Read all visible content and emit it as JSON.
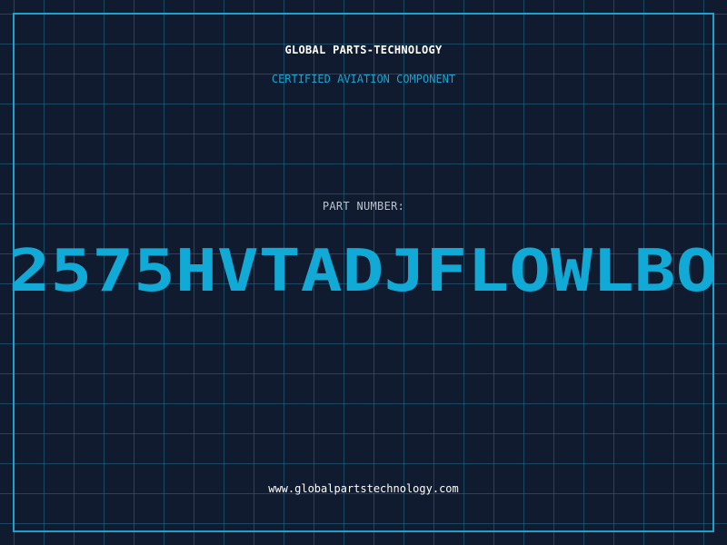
{
  "header": {
    "company_name": "GLOBAL PARTS-TECHNOLOGY",
    "subtitle": "CERTIFIED AVIATION COMPONENT"
  },
  "part": {
    "label": "PART NUMBER:",
    "number": "2575HVTADJFLOWLBO"
  },
  "footer": {
    "website": "www.globalpartstechnology.com"
  },
  "colors": {
    "background": "#111b2f",
    "grid": "#226e8c",
    "accent": "#1aa3cf",
    "text": "#ffffff"
  }
}
